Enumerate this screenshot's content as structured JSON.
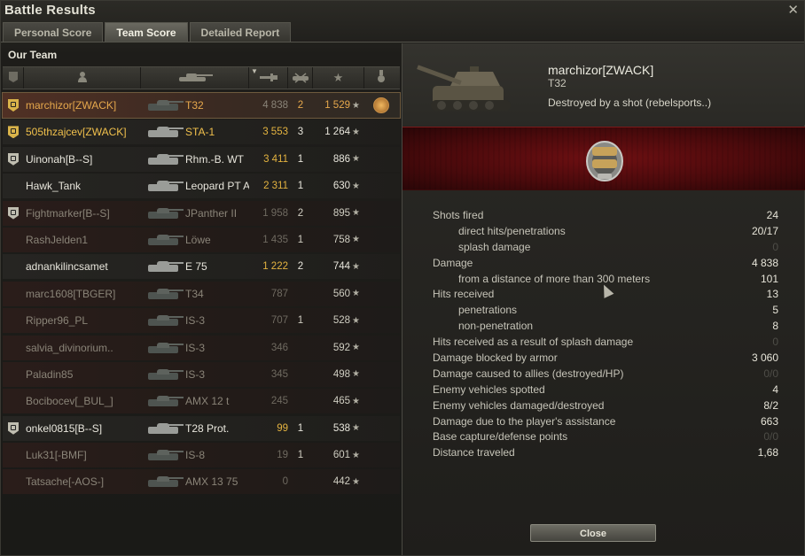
{
  "window": {
    "title": "Battle Results"
  },
  "tabs": [
    {
      "label": "Personal Score",
      "active": false
    },
    {
      "label": "Team Score",
      "active": true
    },
    {
      "label": "Detailed Report",
      "active": false
    }
  ],
  "team": {
    "title": "Our Team",
    "header_icons": [
      "platoon-icon",
      "player-icon",
      "tank-icon",
      "damage-icon",
      "kills-icon",
      "xp-star-icon",
      "achievement-icon"
    ],
    "sorted_by": "damage",
    "rows": [
      {
        "name": "marchizor[ZWACK]",
        "tank": "T32",
        "damage": "4 838",
        "kills": "2",
        "xp": "1 529",
        "state": "player",
        "platoon": "gold",
        "achievement": true
      },
      {
        "name": "505thzajcev[ZWACK]",
        "tank": "STA-1",
        "damage": "3 553",
        "kills": "3",
        "xp": "1 264",
        "state": "clan",
        "platoon": "gold",
        "achievement": false
      },
      {
        "name": "Uinonah[B--S]",
        "tank": "Rhm.-B. WT",
        "damage": "3 411",
        "kills": "1",
        "xp": "886",
        "state": "alive",
        "platoon": "silver",
        "achievement": false
      },
      {
        "name": "Hawk_Tank",
        "tank": "Leopard PT A",
        "damage": "2 311",
        "kills": "1",
        "xp": "630",
        "state": "alive",
        "platoon": "",
        "achievement": false
      },
      {
        "name": "Fightmarker[B--S]",
        "tank": "JPanther II",
        "damage": "1 958",
        "kills": "2",
        "xp": "895",
        "state": "dead",
        "platoon": "silver",
        "achievement": false
      },
      {
        "name": "RashJelden1",
        "tank": "Löwe",
        "damage": "1 435",
        "kills": "1",
        "xp": "758",
        "state": "dead",
        "platoon": "",
        "achievement": false
      },
      {
        "name": "adnankilincsamet",
        "tank": "E 75",
        "damage": "1 222",
        "kills": "2",
        "xp": "744",
        "state": "alive",
        "platoon": "",
        "achievement": false
      },
      {
        "name": "marc1608[TBGER]",
        "tank": "T34",
        "damage": "787",
        "kills": "",
        "xp": "560",
        "state": "dead",
        "platoon": "",
        "achievement": false
      },
      {
        "name": "Ripper96_PL",
        "tank": "IS-3",
        "damage": "707",
        "kills": "1",
        "xp": "528",
        "state": "dead",
        "platoon": "",
        "achievement": false
      },
      {
        "name": "salvia_divinorium..",
        "tank": "IS-3",
        "damage": "346",
        "kills": "",
        "xp": "592",
        "state": "dead",
        "platoon": "",
        "achievement": false
      },
      {
        "name": "Paladin85",
        "tank": "IS-3",
        "damage": "345",
        "kills": "",
        "xp": "498",
        "state": "dead",
        "platoon": "",
        "achievement": false
      },
      {
        "name": "Bocibocev[_BUL_]",
        "tank": "AMX 12 t",
        "damage": "245",
        "kills": "",
        "xp": "465",
        "state": "dead",
        "platoon": "",
        "achievement": false
      },
      {
        "name": "onkel0815[B--S]",
        "tank": "T28 Prot.",
        "damage": "99",
        "kills": "1",
        "xp": "538",
        "state": "alive",
        "platoon": "silver",
        "achievement": false
      },
      {
        "name": "Luk31[-BMF]",
        "tank": "IS-8",
        "damage": "19",
        "kills": "1",
        "xp": "601",
        "state": "dead",
        "platoon": "",
        "achievement": false
      },
      {
        "name": "Tatsache[-AOS-]",
        "tank": "AMX 13 75",
        "damage": "0",
        "kills": "",
        "xp": "442",
        "state": "dead",
        "platoon": "",
        "achievement": false
      }
    ]
  },
  "detail": {
    "player_name": "marchizor[ZWACK]",
    "tank": "T32",
    "fate": "Destroyed by a shot (rebelsports..)",
    "badge_icon": "mastery-badge-icon",
    "stats": [
      {
        "label": "Shots fired",
        "value": "24",
        "sub": false,
        "dim": false
      },
      {
        "label": "direct hits/penetrations",
        "value": "20/17",
        "sub": true,
        "dim": false
      },
      {
        "label": "splash damage",
        "value": "0",
        "sub": true,
        "dim": true
      },
      {
        "label": "Damage",
        "value": "4 838",
        "sub": false,
        "dim": false
      },
      {
        "label": "from a distance of more than 300 meters",
        "value": "101",
        "sub": true,
        "dim": false
      },
      {
        "label": "Hits received",
        "value": "13",
        "sub": false,
        "dim": false
      },
      {
        "label": "penetrations",
        "value": "5",
        "sub": true,
        "dim": false
      },
      {
        "label": "non-penetration",
        "value": "8",
        "sub": true,
        "dim": false
      },
      {
        "label": "Hits received as a result of splash damage",
        "value": "0",
        "sub": false,
        "dim": true
      },
      {
        "label": "Damage blocked by armor",
        "value": "3 060",
        "sub": false,
        "dim": false
      },
      {
        "label": "Damage caused to allies (destroyed/HP)",
        "value": "0/0",
        "sub": false,
        "dim": true
      },
      {
        "label": "Enemy vehicles spotted",
        "value": "4",
        "sub": false,
        "dim": false
      },
      {
        "label": "Enemy vehicles damaged/destroyed",
        "value": "8/2",
        "sub": false,
        "dim": false
      },
      {
        "label": "Damage due to the player's assistance",
        "value": "663",
        "sub": false,
        "dim": false
      },
      {
        "label": "Base capture/defense points",
        "value": "0/0",
        "sub": false,
        "dim": true
      },
      {
        "label": "Distance traveled",
        "value": "1,68",
        "sub": false,
        "dim": false
      }
    ],
    "close_label": "Close"
  }
}
